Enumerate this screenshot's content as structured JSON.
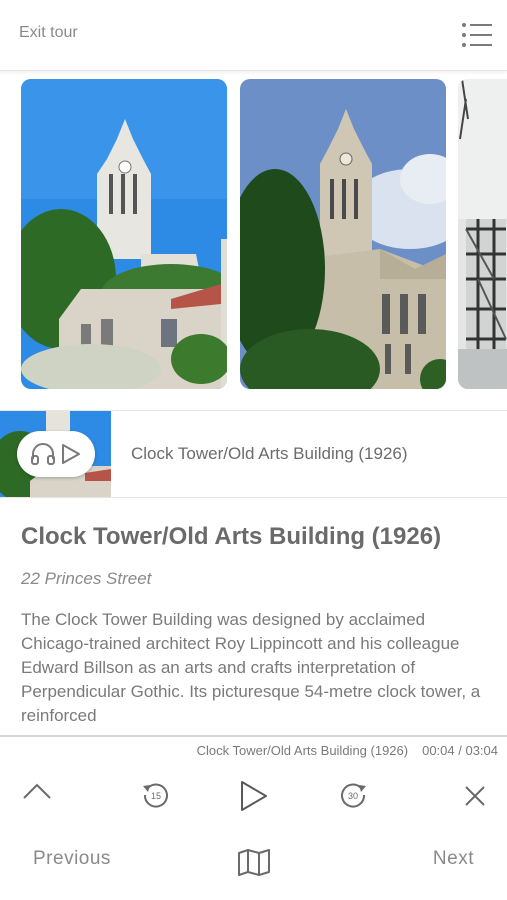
{
  "header": {
    "exit_label": "Exit tour"
  },
  "mini_player": {
    "title": "Clock Tower/Old Arts Building (1926)"
  },
  "stop": {
    "title": "Clock Tower/Old Arts Building (1926)",
    "address": "22 Princes Street",
    "description": "The Clock Tower Building was designed by acclaimed Chicago-trained architect Roy Lippincott and his colleague Edward Billson as an arts and crafts interpretation of Perpendicular Gothic. Its picturesque 54-metre clock tower, a reinforced"
  },
  "audio": {
    "now_playing": "Clock Tower/Old Arts Building (1926)",
    "time": "00:04 / 03:04",
    "rewind_seconds": "15",
    "forward_seconds": "30"
  },
  "footer": {
    "previous_label": "Previous",
    "next_label": "Next"
  },
  "colors": {
    "sky": "#2d8be6",
    "stone": "#d9d4c7",
    "foliage": "#2f6b2a",
    "text": "#6a6a6a"
  },
  "icons": [
    "menu-icon",
    "headphones-icon",
    "play-icon",
    "chevron-up-icon",
    "rewind-15-icon",
    "forward-30-icon",
    "close-icon",
    "map-icon"
  ]
}
